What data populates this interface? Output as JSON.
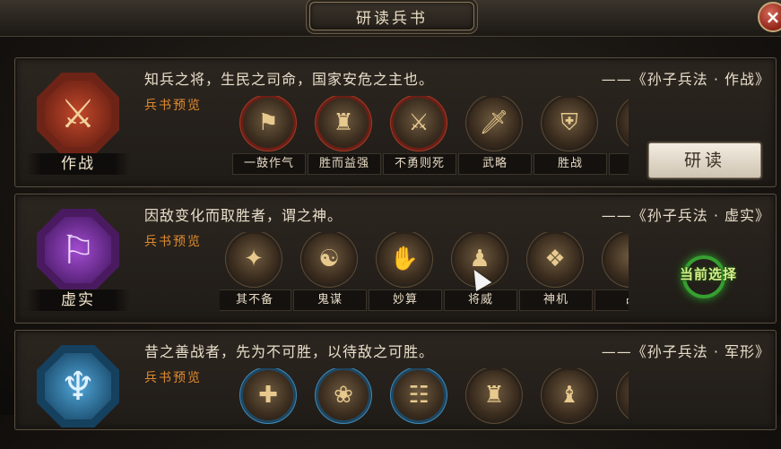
{
  "header": {
    "title": "研读兵书",
    "close_icon": "×"
  },
  "cards": [
    {
      "emblem_name": "作战",
      "emblem_color": "#c4482b",
      "emblem_icon": "crossed-swords-icon",
      "emblem_glyph": "⚔",
      "quote": "知兵之将，生民之司命，国家安危之主也。",
      "source": "——《孙子兵法 · 作战》",
      "preview_label": "兵书预览",
      "ring": "red",
      "skills": [
        {
          "name": "一鼓作气",
          "glyph": "⚑"
        },
        {
          "name": "胜而益强",
          "glyph": "♜"
        },
        {
          "name": "不勇则死",
          "glyph": "⚔"
        },
        {
          "name": "武略",
          "glyph": "🗡"
        },
        {
          "name": "胜战",
          "glyph": "⛨"
        },
        {
          "name": "",
          "glyph": ""
        }
      ],
      "action_label": "研读"
    },
    {
      "emblem_name": "虚实",
      "emblem_color": "#8a3ab0",
      "emblem_icon": "banner-icon",
      "emblem_glyph": "⚐",
      "quote": "因敌变化而取胜者，谓之神。",
      "source": "——《孙子兵法 · 虚实》",
      "preview_label": "兵书预览",
      "ring": "",
      "skills": [
        {
          "name": "其不备",
          "glyph": "✦"
        },
        {
          "name": "鬼谋",
          "glyph": "☯"
        },
        {
          "name": "妙算",
          "glyph": "✋"
        },
        {
          "name": "将威",
          "glyph": "♟"
        },
        {
          "name": "神机",
          "glyph": "❖"
        },
        {
          "name": "占",
          "glyph": ""
        }
      ],
      "current_label": "当前选择"
    },
    {
      "emblem_name": "军形",
      "emblem_color": "#3b8fc4",
      "emblem_icon": "trident-icon",
      "emblem_glyph": "♆",
      "quote": "昔之善战者，先为不可胜，以待敌之可胜。",
      "source": "——《孙子兵法 · 军形》",
      "preview_label": "兵书预览",
      "ring": "blue",
      "skills": [
        {
          "name": "",
          "glyph": "✚"
        },
        {
          "name": "",
          "glyph": "❀"
        },
        {
          "name": "",
          "glyph": "☷"
        },
        {
          "name": "",
          "glyph": "♜"
        },
        {
          "name": "",
          "glyph": "♝"
        },
        {
          "name": "",
          "glyph": ""
        }
      ]
    }
  ]
}
